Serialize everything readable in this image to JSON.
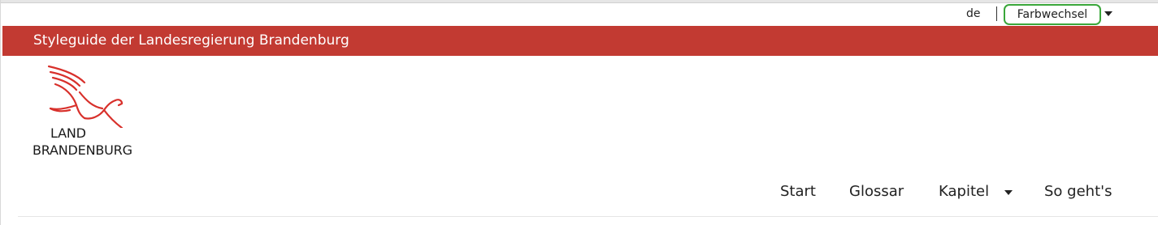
{
  "utility": {
    "language": "de",
    "color_switch_label": "Farbwechsel"
  },
  "header": {
    "site_title": "Styleguide der Landesregierung Brandenburg",
    "bar_color": "#c23a32"
  },
  "logo": {
    "line1": "LAND",
    "line2": "BRANDENBURG",
    "eagle_color": "#d8302b",
    "icon": "brandenburg-eagle-icon"
  },
  "nav": {
    "items": [
      {
        "label": "Start"
      },
      {
        "label": "Glossar"
      },
      {
        "label": "Kapitel",
        "has_dropdown": true
      },
      {
        "label": "So geht's"
      }
    ]
  },
  "colors": {
    "focus_outline": "#3aa63a",
    "text": "#222222"
  }
}
